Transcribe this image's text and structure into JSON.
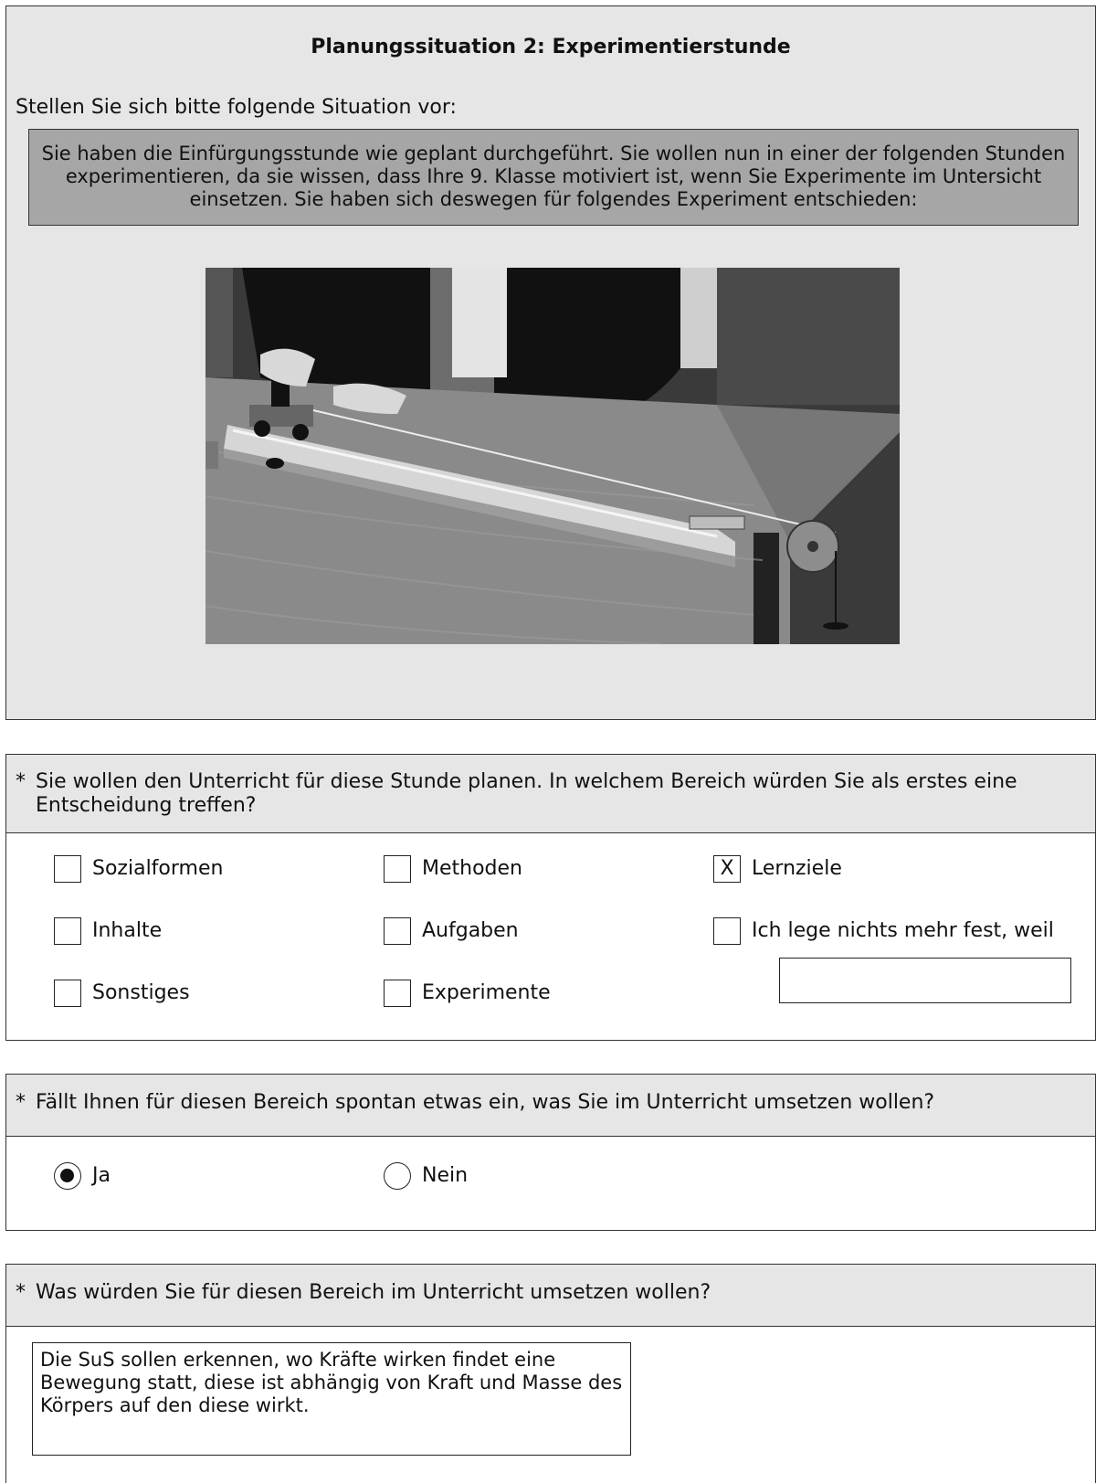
{
  "intro": {
    "title": "Planungssituation 2: Experimentierstunde",
    "lead": "Stellen Sie sich bitte folgende Situation vor:",
    "scenario": "Sie haben die Einfürgungsstunde wie geplant durchgeführt. Sie wollen nun in einer der folgenden Stunden experimentieren, da sie wissen, dass Ihre 9. Klasse motiviert ist, wenn Sie Experimente im Untersicht einsetzen. Sie haben sich deswegen für folgendes Experiment entschieden:",
    "photo_icon": "photo-experiment-cart-track"
  },
  "q1": {
    "star": "*",
    "question": "Sie wollen den Unterricht für diese Stunde planen. In welchem Bereich würden Sie als erstes eine Entscheidung treffen?",
    "options": [
      {
        "label": "Sozialformen",
        "mark": ""
      },
      {
        "label": "Methoden",
        "mark": ""
      },
      {
        "label": "Lernziele",
        "mark": "X"
      },
      {
        "label": "Inhalte",
        "mark": ""
      },
      {
        "label": "Aufgaben",
        "mark": ""
      },
      {
        "label": "Ich lege nichts mehr fest, weil",
        "mark": ""
      },
      {
        "label": "Sonstiges",
        "mark": ""
      },
      {
        "label": "Experimente",
        "mark": ""
      }
    ],
    "reason_value": ""
  },
  "q2": {
    "star": "*",
    "question": "Fällt Ihnen für diesen Bereich spontan etwas ein, was Sie im Unterricht umsetzen wollen?",
    "options": [
      {
        "label": "Ja",
        "selected": true
      },
      {
        "label": "Nein",
        "selected": false
      }
    ]
  },
  "q3": {
    "star": "*",
    "question": "Was würden Sie für diesen Bereich im Unterricht umsetzen wollen?",
    "answer": "Die SuS sollen erkennen, wo Kräfte wirken findet eine Bewegung statt, diese ist abhängig von Kraft und Masse des Körpers auf den diese wirkt."
  }
}
